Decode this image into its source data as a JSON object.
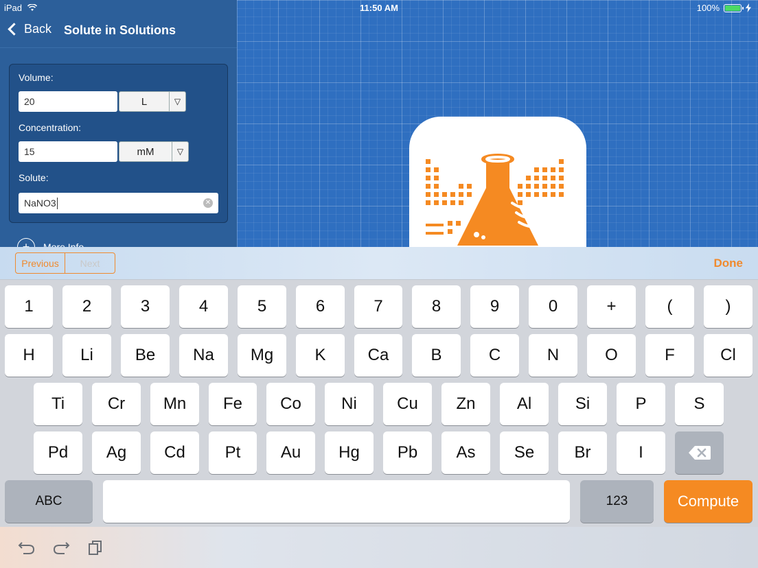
{
  "status_bar": {
    "device": "iPad",
    "time": "11:50 AM",
    "battery": "100%"
  },
  "nav": {
    "back_label": "Back",
    "title": "Solute in Solutions"
  },
  "form": {
    "volume": {
      "label": "Volume:",
      "value": "20",
      "unit": "L"
    },
    "concentration": {
      "label": "Concentration:",
      "value": "15",
      "unit": "mM"
    },
    "solute": {
      "label": "Solute:",
      "value": "NaNO3"
    }
  },
  "more_info": {
    "label": "More Info"
  },
  "accessory": {
    "previous": "Previous",
    "next": "Next",
    "done": "Done"
  },
  "keyboard": {
    "row1": [
      "1",
      "2",
      "3",
      "4",
      "5",
      "6",
      "7",
      "8",
      "9",
      "0",
      "+",
      "(",
      ")"
    ],
    "row2": [
      "H",
      "Li",
      "Be",
      "Na",
      "Mg",
      "K",
      "Ca",
      "B",
      "C",
      "N",
      "O",
      "F",
      "Cl"
    ],
    "row3": [
      "Ti",
      "Cr",
      "Mn",
      "Fe",
      "Co",
      "Ni",
      "Cu",
      "Zn",
      "Al",
      "Si",
      "P",
      "S"
    ],
    "row4": [
      "Pd",
      "Ag",
      "Cd",
      "Pt",
      "Au",
      "Hg",
      "Pb",
      "As",
      "Se",
      "Br",
      "I"
    ],
    "abc": "ABC",
    "num": "123",
    "compute": "Compute"
  },
  "colors": {
    "accent": "#f58a22",
    "panel": "#2c5f9a",
    "blueprint": "#2f6fc0"
  }
}
